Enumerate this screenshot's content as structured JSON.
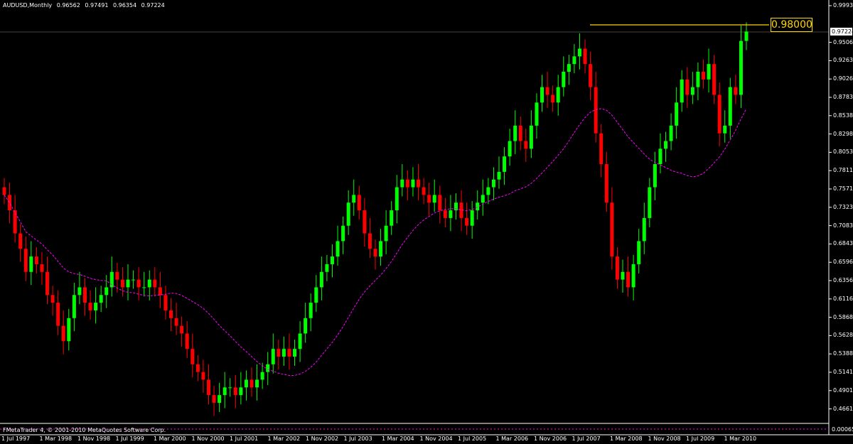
{
  "header": {
    "symbol": "AUDUSD,Monthly",
    "open": "0.96562",
    "high": "0.97491",
    "low": "0.96354",
    "close": "0.97224"
  },
  "footer": {
    "copyright": "FMetaTrader 4, © 2001-2010 MetaQuotes Software Corp."
  },
  "level_line": {
    "label": "0.98000",
    "value": 0.98,
    "color": "#ffd700"
  },
  "current_price": "0.97224",
  "price_axis": {
    "labels": [
      "0.99935",
      "0.97224",
      "0.95060",
      "0.92635",
      "0.90260",
      "0.87835",
      "0.85385",
      "0.82985",
      "0.80535",
      "0.78110",
      "0.75710",
      "0.73235",
      "0.70835",
      "0.68435",
      "0.65960",
      "0.63560",
      "0.61160",
      "0.58685",
      "0.56285",
      "0.53885",
      "0.51410",
      "0.49010",
      "0.46610"
    ],
    "bottom": "0.00065"
  },
  "date_axis": {
    "labels": [
      "1 Jul 1997",
      "1 Mar 1998",
      "1 Nov 1998",
      "1 Jul 1999",
      "1 Mar 2000",
      "1 Nov 2000",
      "1 Jul 2001",
      "1 Mar 2002",
      "1 Nov 2002",
      "1 Jul 2003",
      "1 Mar 2004",
      "1 Nov 2004",
      "1 Jul 2005",
      "1 Mar 2006",
      "1 Nov 2006",
      "1 Jul 2007",
      "1 Mar 2008",
      "1 Nov 2008",
      "1 Jul 2009",
      "1 Mar 2010"
    ]
  },
  "colors": {
    "background": "#000000",
    "bull": "#00ff00",
    "bear": "#ff0000",
    "moving_average": "#ff00ff",
    "grid": "#ffffff"
  },
  "chart_data": {
    "type": "candlestick",
    "series_ma": "moving average (dotted)",
    "ylim": [
      0.466,
      0.99935
    ],
    "closes": [
      0.76,
      0.74,
      0.71,
      0.69,
      0.66,
      0.68,
      0.67,
      0.66,
      0.63,
      0.62,
      0.59,
      0.57,
      0.6,
      0.63,
      0.64,
      0.62,
      0.61,
      0.62,
      0.63,
      0.64,
      0.66,
      0.65,
      0.64,
      0.65,
      0.65,
      0.64,
      0.64,
      0.65,
      0.64,
      0.63,
      0.61,
      0.6,
      0.59,
      0.58,
      0.56,
      0.54,
      0.53,
      0.52,
      0.5,
      0.49,
      0.5,
      0.51,
      0.51,
      0.5,
      0.51,
      0.52,
      0.51,
      0.52,
      0.53,
      0.54,
      0.56,
      0.55,
      0.56,
      0.55,
      0.56,
      0.58,
      0.6,
      0.62,
      0.64,
      0.66,
      0.67,
      0.68,
      0.7,
      0.72,
      0.75,
      0.76,
      0.74,
      0.71,
      0.69,
      0.68,
      0.7,
      0.72,
      0.74,
      0.77,
      0.78,
      0.77,
      0.78,
      0.77,
      0.76,
      0.75,
      0.76,
      0.74,
      0.73,
      0.74,
      0.75,
      0.73,
      0.72,
      0.74,
      0.75,
      0.76,
      0.77,
      0.78,
      0.79,
      0.81,
      0.83,
      0.85,
      0.83,
      0.82,
      0.85,
      0.88,
      0.9,
      0.89,
      0.88,
      0.9,
      0.92,
      0.93,
      0.94,
      0.95,
      0.93,
      0.9,
      0.84,
      0.8,
      0.75,
      0.68,
      0.65,
      0.66,
      0.64,
      0.67,
      0.7,
      0.73,
      0.77,
      0.8,
      0.82,
      0.83,
      0.85,
      0.88,
      0.91,
      0.89,
      0.9,
      0.92,
      0.91,
      0.93,
      0.89,
      0.84,
      0.85,
      0.9,
      0.89,
      0.96,
      0.97224
    ]
  }
}
